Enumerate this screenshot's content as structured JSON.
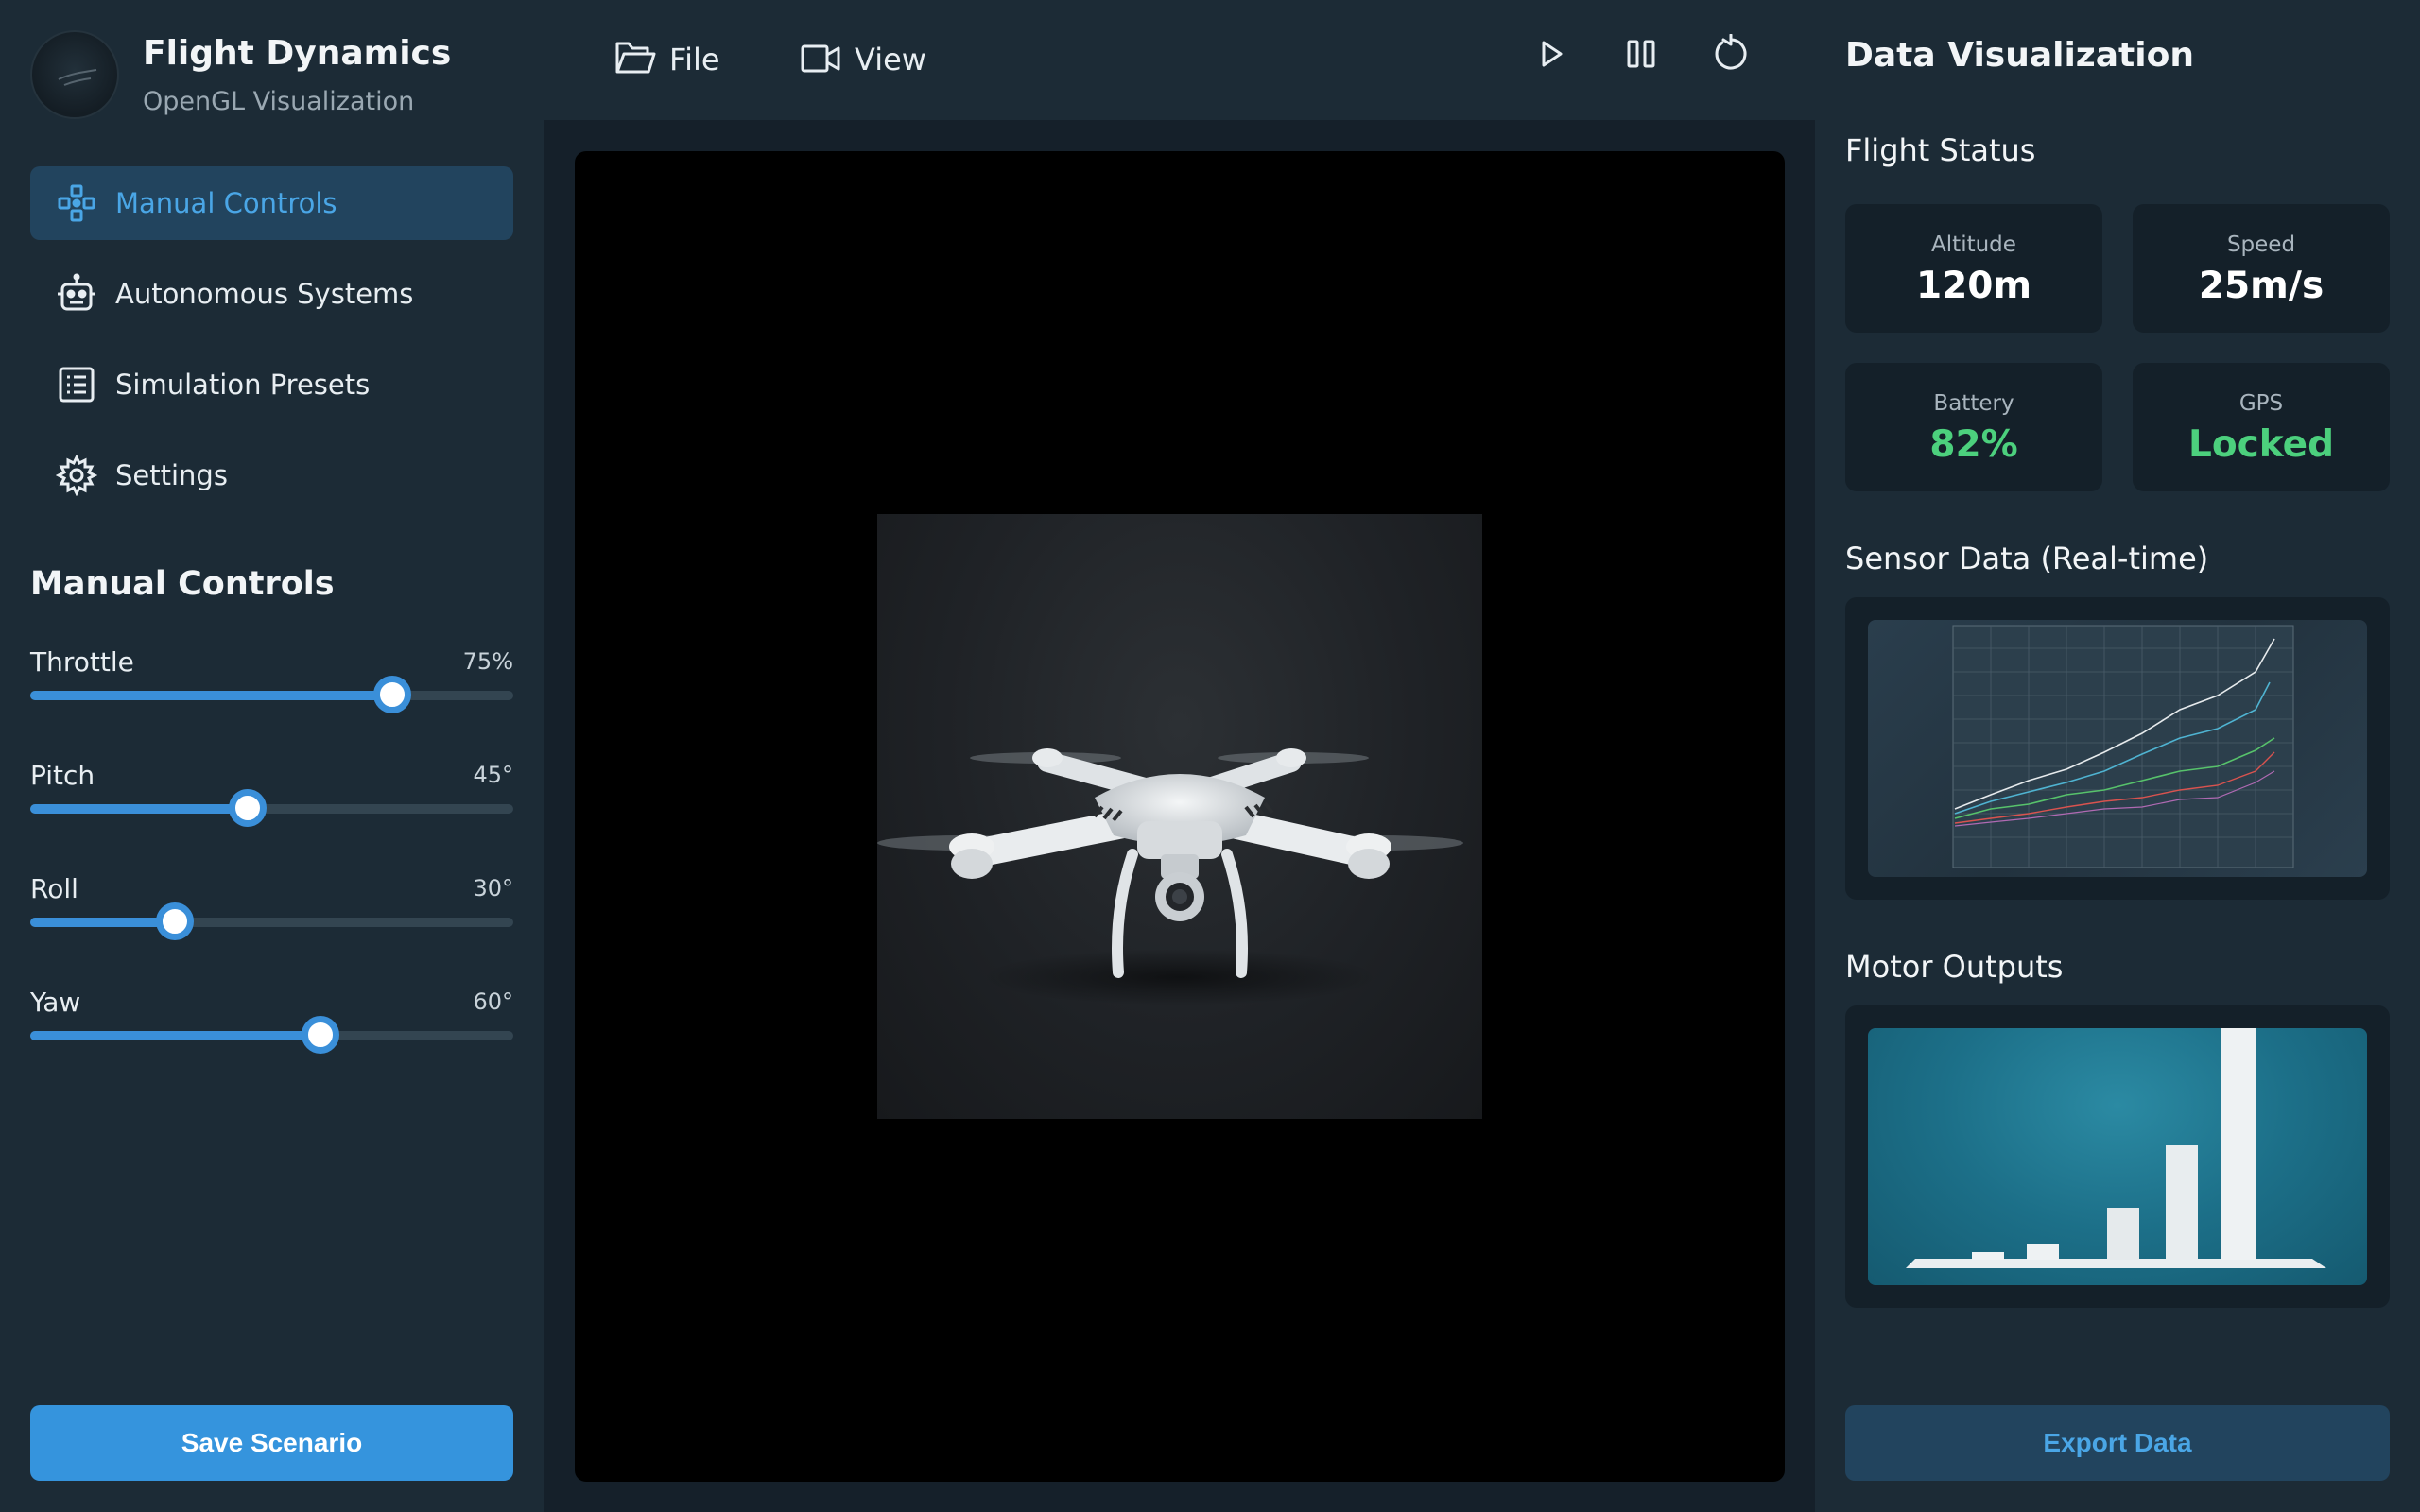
{
  "brand": {
    "title": "Flight Dynamics",
    "subtitle": "OpenGL Visualization"
  },
  "nav": {
    "items": [
      {
        "label": "Manual Controls",
        "icon": "gamepad-icon",
        "active": true
      },
      {
        "label": "Autonomous Systems",
        "icon": "robot-icon",
        "active": false
      },
      {
        "label": "Simulation Presets",
        "icon": "list-icon",
        "active": false
      },
      {
        "label": "Settings",
        "icon": "gear-icon",
        "active": false
      }
    ]
  },
  "manual_controls": {
    "title": "Manual Controls",
    "sliders": [
      {
        "label": "Throttle",
        "value_text": "75%",
        "fraction": 0.75
      },
      {
        "label": "Pitch",
        "value_text": "45°",
        "fraction": 0.45
      },
      {
        "label": "Roll",
        "value_text": "30°",
        "fraction": 0.3
      },
      {
        "label": "Yaw",
        "value_text": "60°",
        "fraction": 0.6
      }
    ]
  },
  "sidebar": {
    "save_label": "Save Scenario"
  },
  "toolbar": {
    "file_label": "File",
    "view_label": "View",
    "controls": [
      "play-icon",
      "pause-icon",
      "reset-icon"
    ]
  },
  "right": {
    "title": "Data Visualization",
    "flight_status_title": "Flight Status",
    "stats": [
      {
        "label": "Altitude",
        "value": "120m",
        "status": "normal"
      },
      {
        "label": "Speed",
        "value": "25m/s",
        "status": "normal"
      },
      {
        "label": "Battery",
        "value": "82%",
        "status": "good"
      },
      {
        "label": "GPS",
        "value": "Locked",
        "status": "good"
      }
    ],
    "sensor_title": "Sensor Data (Real-time)",
    "motor_title": "Motor Outputs",
    "export_label": "Export Data"
  },
  "colors": {
    "accent": "#3594dd",
    "good": "#4cd07d",
    "panel": "#142029",
    "background": "#1c2b36"
  }
}
